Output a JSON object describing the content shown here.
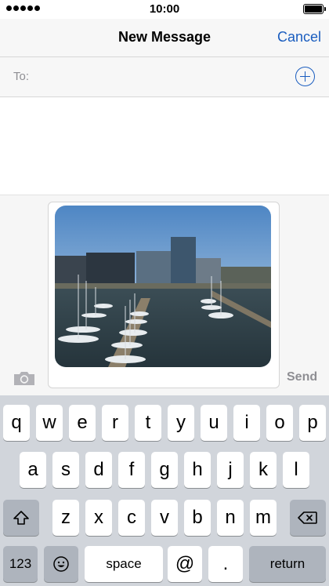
{
  "status_bar": {
    "time": "10:00"
  },
  "header": {
    "title": "New Message",
    "cancel_label": "Cancel"
  },
  "recipient": {
    "label": "To:"
  },
  "compose": {
    "send_label": "Send"
  },
  "keyboard": {
    "row1": [
      "q",
      "w",
      "e",
      "r",
      "t",
      "y",
      "u",
      "i",
      "o",
      "p"
    ],
    "row2": [
      "a",
      "s",
      "d",
      "f",
      "g",
      "h",
      "j",
      "k",
      "l"
    ],
    "row3": [
      "z",
      "x",
      "c",
      "v",
      "b",
      "n",
      "m"
    ],
    "numbers_label": "123",
    "space_label": "space",
    "at_label": "@",
    "period_label": ".",
    "return_label": "return"
  },
  "colors": {
    "accent": "#1a5dbf",
    "keyboard_bg": "#d1d5db",
    "function_key": "#aeb4bd"
  },
  "icons": [
    "signal-dots-icon",
    "battery-icon",
    "add-contact-icon",
    "camera-icon",
    "shift-icon",
    "delete-icon",
    "emoji-icon"
  ]
}
